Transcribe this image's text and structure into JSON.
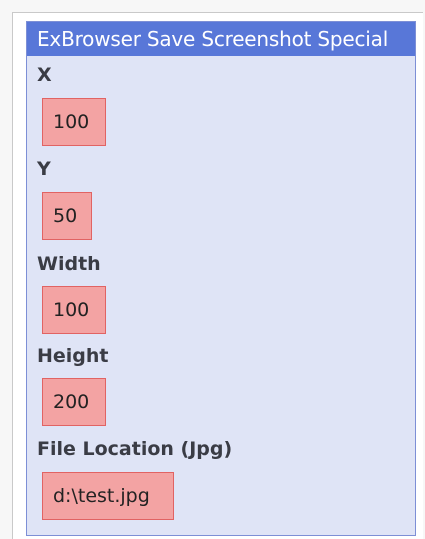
{
  "panel": {
    "title": "ExBrowser Save Screenshot Special",
    "fields": {
      "x": {
        "label": "X",
        "value": "100"
      },
      "y": {
        "label": "Y",
        "value": "50"
      },
      "width": {
        "label": "Width",
        "value": "100"
      },
      "height": {
        "label": "Height",
        "value": "200"
      },
      "file_location": {
        "label": "File Location (Jpg)",
        "value": "d:\\test.jpg"
      }
    }
  },
  "colors": {
    "header_bg": "#5877d8",
    "panel_bg": "#dfe4f6",
    "input_bg": "#f3a3a3",
    "input_border": "#e16363",
    "label_text": "#3a3c45"
  }
}
